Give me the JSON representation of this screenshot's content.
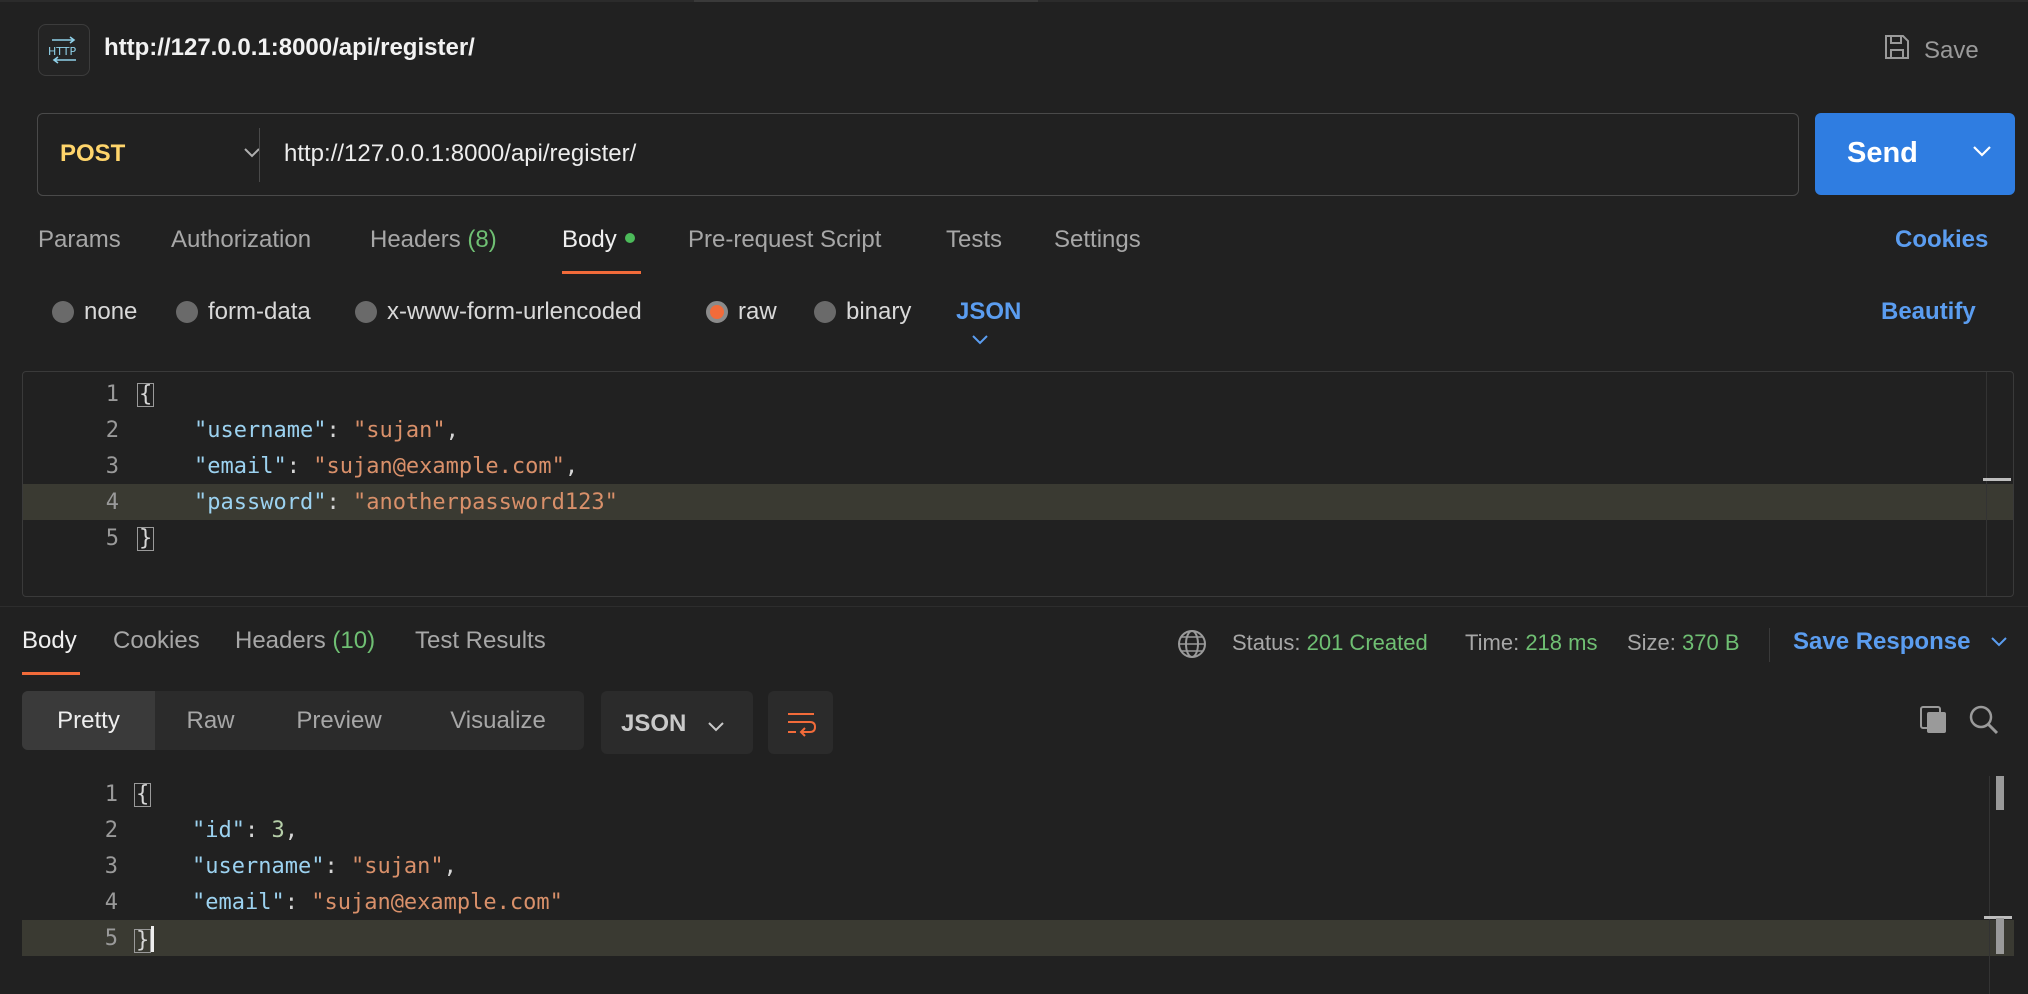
{
  "header": {
    "badge_icon": "http-icon",
    "title": "http://127.0.0.1:8000/api/register/",
    "save_label": "Save"
  },
  "request": {
    "method": "POST",
    "url": "http://127.0.0.1:8000/api/register/",
    "send_label": "Send"
  },
  "request_tabs": {
    "params": "Params",
    "authorization": "Authorization",
    "headers_label": "Headers",
    "headers_count": "(8)",
    "body": "Body",
    "pre_request": "Pre-request Script",
    "tests": "Tests",
    "settings": "Settings",
    "cookies": "Cookies"
  },
  "body_types": {
    "none": "none",
    "form_data": "form-data",
    "urlencoded": "x-www-form-urlencoded",
    "raw": "raw",
    "binary": "binary",
    "format": "JSON",
    "beautify": "Beautify"
  },
  "request_body": {
    "line_numbers": [
      "1",
      "2",
      "3",
      "4",
      "5"
    ],
    "open_brace": "{",
    "close_brace": "}",
    "username_key": "\"username\"",
    "username_value": "\"sujan\"",
    "email_key": "\"email\"",
    "email_value": "\"sujan@example.com\"",
    "password_key": "\"password\"",
    "password_value": "\"anotherpassword123\""
  },
  "response_tabs": {
    "body": "Body",
    "cookies": "Cookies",
    "headers_label": "Headers",
    "headers_count": "(10)",
    "test_results": "Test Results"
  },
  "response_status": {
    "status_label": "Status:",
    "status_value": "201 Created",
    "time_label": "Time:",
    "time_value": "218 ms",
    "size_label": "Size:",
    "size_value": "370 B",
    "save_response": "Save Response"
  },
  "response_view": {
    "pretty": "Pretty",
    "raw": "Raw",
    "preview": "Preview",
    "visualize": "Visualize",
    "format": "JSON"
  },
  "response_body": {
    "line_numbers": [
      "1",
      "2",
      "3",
      "4",
      "5"
    ],
    "open_brace": "{",
    "close_brace": "}",
    "id_key": "\"id\"",
    "id_value": "3",
    "username_key": "\"username\"",
    "username_value": "\"sujan\"",
    "email_key": "\"email\"",
    "email_value": "\"sujan@example.com\""
  },
  "colors": {
    "background": "#212121",
    "accent_blue": "#2f7de1",
    "method_yellow": "#ffd56b",
    "status_green": "#6fbf73",
    "tab_underline": "#f26b3a"
  }
}
